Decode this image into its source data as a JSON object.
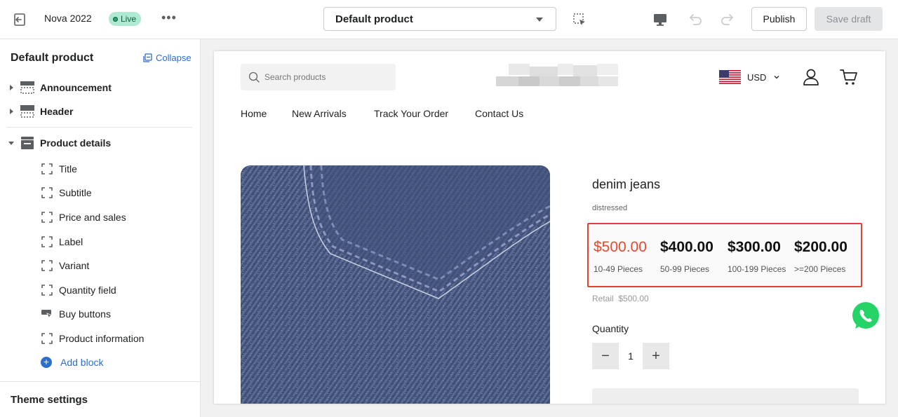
{
  "topbar": {
    "store_name": "Nova 2022",
    "status": "Live",
    "more": "•••",
    "template_select": "Default product",
    "publish_label": "Publish",
    "save_label": "Save draft"
  },
  "sidebar": {
    "title": "Default product",
    "collapse_label": "Collapse",
    "sections": [
      {
        "label": "Announcement"
      },
      {
        "label": "Header"
      },
      {
        "label": "Product details"
      }
    ],
    "blocks": [
      {
        "label": "Title"
      },
      {
        "label": "Subtitle"
      },
      {
        "label": "Price and sales"
      },
      {
        "label": "Label"
      },
      {
        "label": "Variant"
      },
      {
        "label": "Quantity field"
      },
      {
        "label": "Buy buttons"
      },
      {
        "label": "Product information"
      }
    ],
    "add_block_label": "Add block",
    "theme_settings_label": "Theme settings"
  },
  "preview": {
    "search_placeholder": "Search products",
    "currency": "USD",
    "nav": [
      "Home",
      "New Arrivals",
      "Track Your Order",
      "Contact Us"
    ],
    "product_title": "denim jeans",
    "product_subtitle": "distressed",
    "tiers": [
      {
        "price": "$500.00",
        "qty": "10-49 Pieces"
      },
      {
        "price": "$400.00",
        "qty": "50-99 Pieces"
      },
      {
        "price": "$300.00",
        "qty": "100-199 Pieces"
      },
      {
        "price": "$200.00",
        "qty": ">=200 Pieces"
      }
    ],
    "retail": "Retail  $500.00",
    "quantity_label": "Quantity",
    "quantity_value": "1",
    "minus": "−",
    "plus": "+"
  },
  "colors": {
    "accent_blue": "#2c6ecb",
    "live_badge": "#aee9d1",
    "highlight_border": "#e0423a",
    "first_tier_price": "#e8492f",
    "whatsapp": "#25d366"
  },
  "icons": {
    "exit": "exit-icon",
    "inspect": "inspect-icon",
    "desktop": "desktop-icon",
    "undo": "undo-icon",
    "redo": "redo-icon",
    "search": "search-icon",
    "user": "user-icon",
    "cart": "cart-icon",
    "whatsapp": "whatsapp-icon"
  }
}
